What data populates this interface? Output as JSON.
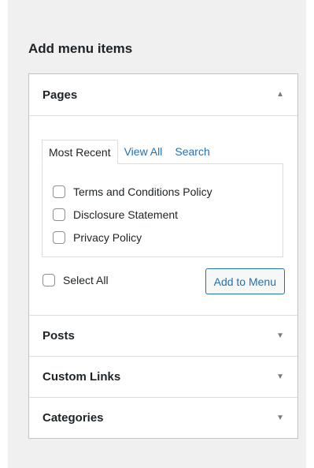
{
  "heading": "Add menu items",
  "sections": {
    "pages": {
      "title": "Pages",
      "arrow": "▲",
      "tabs": [
        "Most Recent",
        "View All",
        "Search"
      ],
      "items": [
        "Terms and Conditions Policy",
        "Disclosure Statement",
        "Privacy Policy"
      ],
      "select_all_label": "Select All",
      "add_button_label": "Add to Menu"
    },
    "posts": {
      "title": "Posts",
      "arrow": "▼"
    },
    "custom_links": {
      "title": "Custom Links",
      "arrow": "▼"
    },
    "categories": {
      "title": "Categories",
      "arrow": "▼"
    }
  },
  "colors": {
    "link": "#2271b1",
    "text": "#1d2327",
    "border": "#c3c4c7",
    "panel_bg": "#f0f0f1"
  },
  "icons": {
    "expanded": "arrow-up-icon",
    "collapsed": "arrow-down-icon",
    "checkbox": "checkbox-icon"
  }
}
